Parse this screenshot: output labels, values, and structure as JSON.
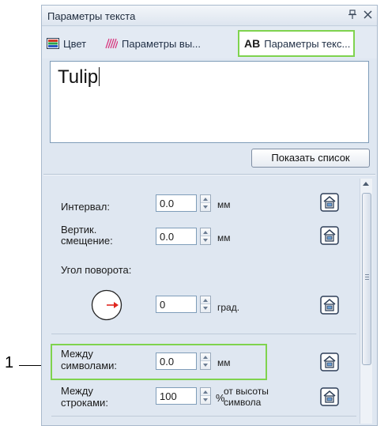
{
  "callout": {
    "number": "1"
  },
  "panel": {
    "title": "Параметры текста",
    "pin_glyph": "ᵖ",
    "close_glyph": "✕"
  },
  "tabs": [
    {
      "label": "Цвет",
      "icon": "color-swatch-icon"
    },
    {
      "label": "Параметры вы...",
      "icon": "stitch-pattern-icon"
    },
    {
      "label": "Параметры текс...",
      "icon": "ab-text-icon",
      "icon_text": "AB",
      "active": true
    }
  ],
  "text_input": {
    "value": "Tulip"
  },
  "buttons": {
    "show_list": "Показать список"
  },
  "settings": {
    "interval": {
      "label": "Интервал:",
      "value": "0.0",
      "unit": "мм"
    },
    "vertical_offset": {
      "label_line1": "Вертик.",
      "label_line2": "смещение:",
      "value": "0.0",
      "unit": "мм"
    },
    "rotation": {
      "label": "Угол поворота:",
      "value": "0",
      "unit": "град."
    },
    "char_spacing": {
      "label_line1": "Между",
      "label_line2": "символами:",
      "value": "0.0",
      "unit": "мм",
      "highlighted": true
    },
    "line_spacing": {
      "label_line1": "Между",
      "label_line2": "строками:",
      "value": "100",
      "unit_symbol": "%",
      "unit_line1": "от высоты",
      "unit_line2": "символа"
    }
  },
  "colors": {
    "highlight": "#7fd34e",
    "accent_arrow": "#e0261f",
    "panel_bg": "#dfe7f1"
  }
}
